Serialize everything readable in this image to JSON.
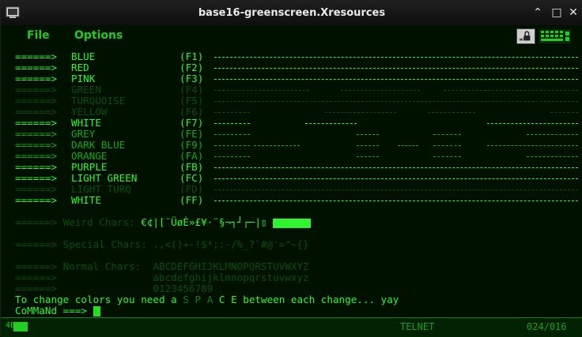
{
  "window": {
    "title": "base16-greenscreen.Xresources"
  },
  "menu": {
    "items": [
      "File",
      "Options"
    ]
  },
  "colors": {
    "bright": "#2ef52e",
    "dim": "#15a815",
    "dark": "#0c4d0c",
    "background": "#001100"
  },
  "color_rows": [
    {
      "arrow": "======>",
      "name": "BLUE",
      "key": "(F1)",
      "shade": "b"
    },
    {
      "arrow": "======>",
      "name": "RED",
      "key": "(F2)",
      "shade": "b"
    },
    {
      "arrow": "======>",
      "name": "PINK",
      "key": "(F3)",
      "shade": "b"
    },
    {
      "arrow": "======>",
      "name": "GREEN",
      "key": "(F4)",
      "shade": "d"
    },
    {
      "arrow": "======>",
      "name": "TURQUOISE",
      "key": "(F5)",
      "shade": "d"
    },
    {
      "arrow": "======>",
      "name": "YELLOW",
      "key": "(F6)",
      "shade": "d"
    },
    {
      "arrow": "======>",
      "name": "WHITE",
      "key": "(F7)",
      "shade": "b"
    },
    {
      "arrow": "======>",
      "name": "GREY",
      "key": "(FE)",
      "shade": "n"
    },
    {
      "arrow": "======>",
      "name": "DARK BLUE",
      "key": "(F9)",
      "shade": "n"
    },
    {
      "arrow": "======>",
      "name": "ORANGE",
      "key": "(FA)",
      "shade": "n"
    },
    {
      "arrow": "======>",
      "name": "PURPLE",
      "key": "(FB)",
      "shade": "b"
    },
    {
      "arrow": "======>",
      "name": "LIGHT GREEN",
      "key": "(FC)",
      "shade": "b"
    },
    {
      "arrow": "======>",
      "name": "LIGHT TURQ",
      "key": "(FD)",
      "shade": "d"
    },
    {
      "arrow": "======>",
      "name": "WHITE",
      "key": "(FF)",
      "shade": "b"
    }
  ],
  "weird": {
    "arrow": "======>",
    "label": "Weird Chars:",
    "chars": "€¢|[¨ÜøÈ»£¥·¨§¬┐┘┌─|▯"
  },
  "special": {
    "arrow": "======>",
    "label": "Special Chars:",
    "chars": ".,<()+-!$*;:-/%_?`#@'=\"~{}"
  },
  "normal": {
    "arrow": "======>",
    "label": "Normal Chars:",
    "upper": "ABCDEFGHIJKLMNOPQRSTUVWXYZ",
    "lower": "abcdefghijklmnopqrstuvwxyz",
    "digits": "0123456789"
  },
  "message": {
    "pre": "To change colors you need a ",
    "s": "S",
    "p": "P",
    "a": "A",
    "c": "C",
    "e": "E",
    "post": " between each change... yay"
  },
  "prompt": {
    "text": "CoMMaNd ===> "
  },
  "status": {
    "left": "4B",
    "mode": "TELNET",
    "position": "024/016"
  }
}
